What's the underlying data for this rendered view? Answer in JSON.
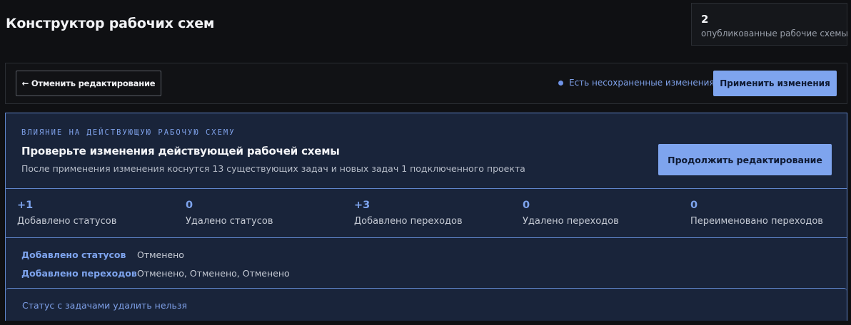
{
  "header": {
    "title": "Конструктор рабочих схем"
  },
  "published_stat": {
    "value": "2",
    "label": "опубликованные рабочие схемы"
  },
  "toolbar": {
    "cancel_label": "← Отменить редактирование",
    "unsaved_label": "Есть несохраненные изменения",
    "apply_label": "Применить изменения"
  },
  "impact": {
    "kicker": "ВЛИЯНИЕ НА ДЕЙСТВУЮЩУЮ РАБОЧУЮ СХЕМУ",
    "title": "Проверьте изменения действующей рабочей схемы",
    "description": "После применения изменения коснутся 13 существующих задач и новых задач 1 подключенного проекта",
    "continue_label": "Продолжить редактирование"
  },
  "metrics": [
    {
      "value": "+1",
      "label": "Добавлено статусов"
    },
    {
      "value": "0",
      "label": "Удалено статусов"
    },
    {
      "value": "+3",
      "label": "Добавлено переходов"
    },
    {
      "value": "0",
      "label": "Удалено переходов"
    },
    {
      "value": "0",
      "label": "Переименовано переходов"
    }
  ],
  "details": [
    {
      "key": "Добавлено статусов",
      "value": "Отменено"
    },
    {
      "key": "Добавлено переходов",
      "value": "Отменено, Отменено, Отменено"
    }
  ],
  "warning": {
    "text": "Статус с задачами удалить нельзя"
  },
  "colors": {
    "accent": "#7ea4ee",
    "panel_bg": "#19243a",
    "panel_border": "#5f84c9",
    "page_bg": "#0f1013"
  }
}
